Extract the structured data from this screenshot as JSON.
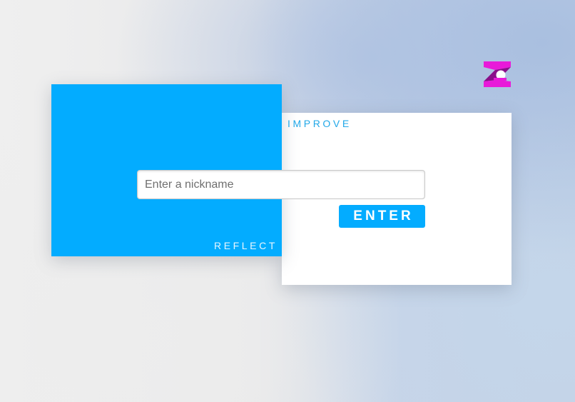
{
  "logo": {
    "icon": "z-logo-icon",
    "colors": {
      "primary": "#e81ad9",
      "dark": "#8a0f8a",
      "dot": "#ffffff"
    }
  },
  "improve_card": {
    "label": "IMPROVE"
  },
  "reflect_card": {
    "label": "REFLECT"
  },
  "form": {
    "nickname_placeholder": "Enter a nickname",
    "nickname_value": "",
    "enter_label": "ENTER"
  },
  "colors": {
    "accent": "#03acff",
    "card": "#ffffff"
  }
}
